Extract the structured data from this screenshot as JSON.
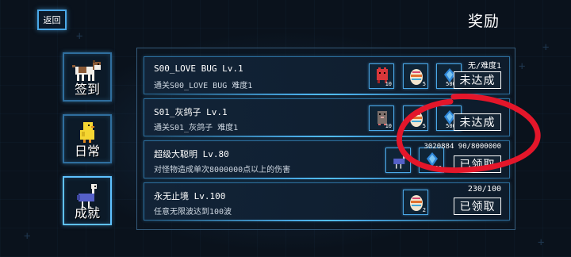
{
  "header": {
    "back_label": "返回",
    "title": "奖励"
  },
  "sidebar": {
    "tabs": [
      {
        "label": "签到",
        "icon": "dog-icon"
      },
      {
        "label": "日常",
        "icon": "chick-icon"
      },
      {
        "label": "成就",
        "icon": "ostrich-icon",
        "selected": true
      }
    ]
  },
  "quests": [
    {
      "title": "S00_LOVE BUG Lv.1",
      "desc": "通关S00_LOVE BUG 难度1",
      "progress": "无/难度1",
      "button": "未达成",
      "rewards": [
        {
          "icon": "red-creature-icon",
          "count": "10"
        },
        {
          "icon": "egg-icon",
          "count": "5"
        },
        {
          "icon": "crystal-icon",
          "count": "5000"
        }
      ]
    },
    {
      "title": "S01_灰鸽子 Lv.1",
      "desc": "通关S01_灰鸽子 难度1",
      "progress": "",
      "button": "未达成",
      "rewards": [
        {
          "icon": "pigeon-icon",
          "count": "10"
        },
        {
          "icon": "egg-icon",
          "count": "5"
        },
        {
          "icon": "crystal-icon",
          "count": "5000"
        }
      ]
    },
    {
      "title": "超级大聪明 Lv.80",
      "desc": "对怪物造成单次8000000点以上的伤害",
      "progress": "3020884 90/8000000",
      "button": "已领取",
      "rewards": [
        {
          "icon": "ostrich-icon",
          "count": ""
        },
        {
          "icon": "crystal-icon",
          "count": "500"
        }
      ]
    },
    {
      "title": "永无止境 Lv.100",
      "desc": "任意无限波达到100波",
      "progress": "230/100",
      "button": "已领取",
      "rewards": [
        {
          "icon": "egg-icon",
          "count": "2"
        }
      ]
    }
  ],
  "colors": {
    "accent": "#4aa8e8",
    "annotation": "#e4162a",
    "background": "#0a121c"
  }
}
